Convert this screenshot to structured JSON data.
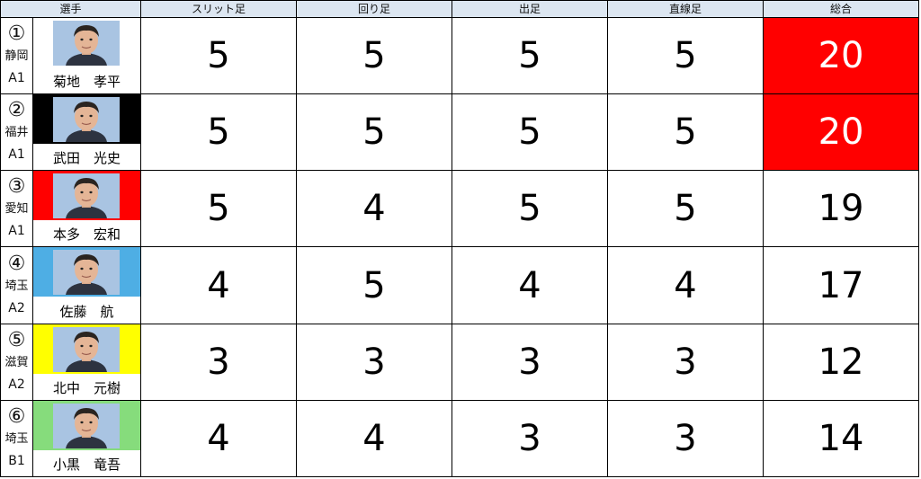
{
  "headers": [
    "選手",
    "スリット足",
    "回り足",
    "出足",
    "直線足",
    "総合"
  ],
  "colors": {
    "header_bg": "#dce6f1",
    "highlight": "#ff0000"
  },
  "rows": [
    {
      "num": "①",
      "pref": "静岡",
      "grade": "A1",
      "name": "菊地　孝平",
      "band": "#ffffff",
      "scores": [
        "5",
        "5",
        "5",
        "5"
      ],
      "total": "20",
      "highlight": true
    },
    {
      "num": "②",
      "pref": "福井",
      "grade": "A1",
      "name": "武田　光史",
      "band": "#000000",
      "scores": [
        "5",
        "5",
        "5",
        "5"
      ],
      "total": "20",
      "highlight": true
    },
    {
      "num": "③",
      "pref": "愛知",
      "grade": "A1",
      "name": "本多　宏和",
      "band": "#ff0000",
      "scores": [
        "5",
        "4",
        "5",
        "5"
      ],
      "total": "19",
      "highlight": false
    },
    {
      "num": "④",
      "pref": "埼玉",
      "grade": "A2",
      "name": "佐藤　航",
      "band": "#4eaee4",
      "scores": [
        "4",
        "5",
        "4",
        "4"
      ],
      "total": "17",
      "highlight": false
    },
    {
      "num": "⑤",
      "pref": "滋賀",
      "grade": "A2",
      "name": "北中　元樹",
      "band": "#ffff00",
      "scores": [
        "3",
        "3",
        "3",
        "3"
      ],
      "total": "12",
      "highlight": false
    },
    {
      "num": "⑥",
      "pref": "埼玉",
      "grade": "B1",
      "name": "小黒　竜吾",
      "band": "#86dc7c",
      "scores": [
        "4",
        "4",
        "3",
        "3"
      ],
      "total": "14",
      "highlight": false
    }
  ]
}
